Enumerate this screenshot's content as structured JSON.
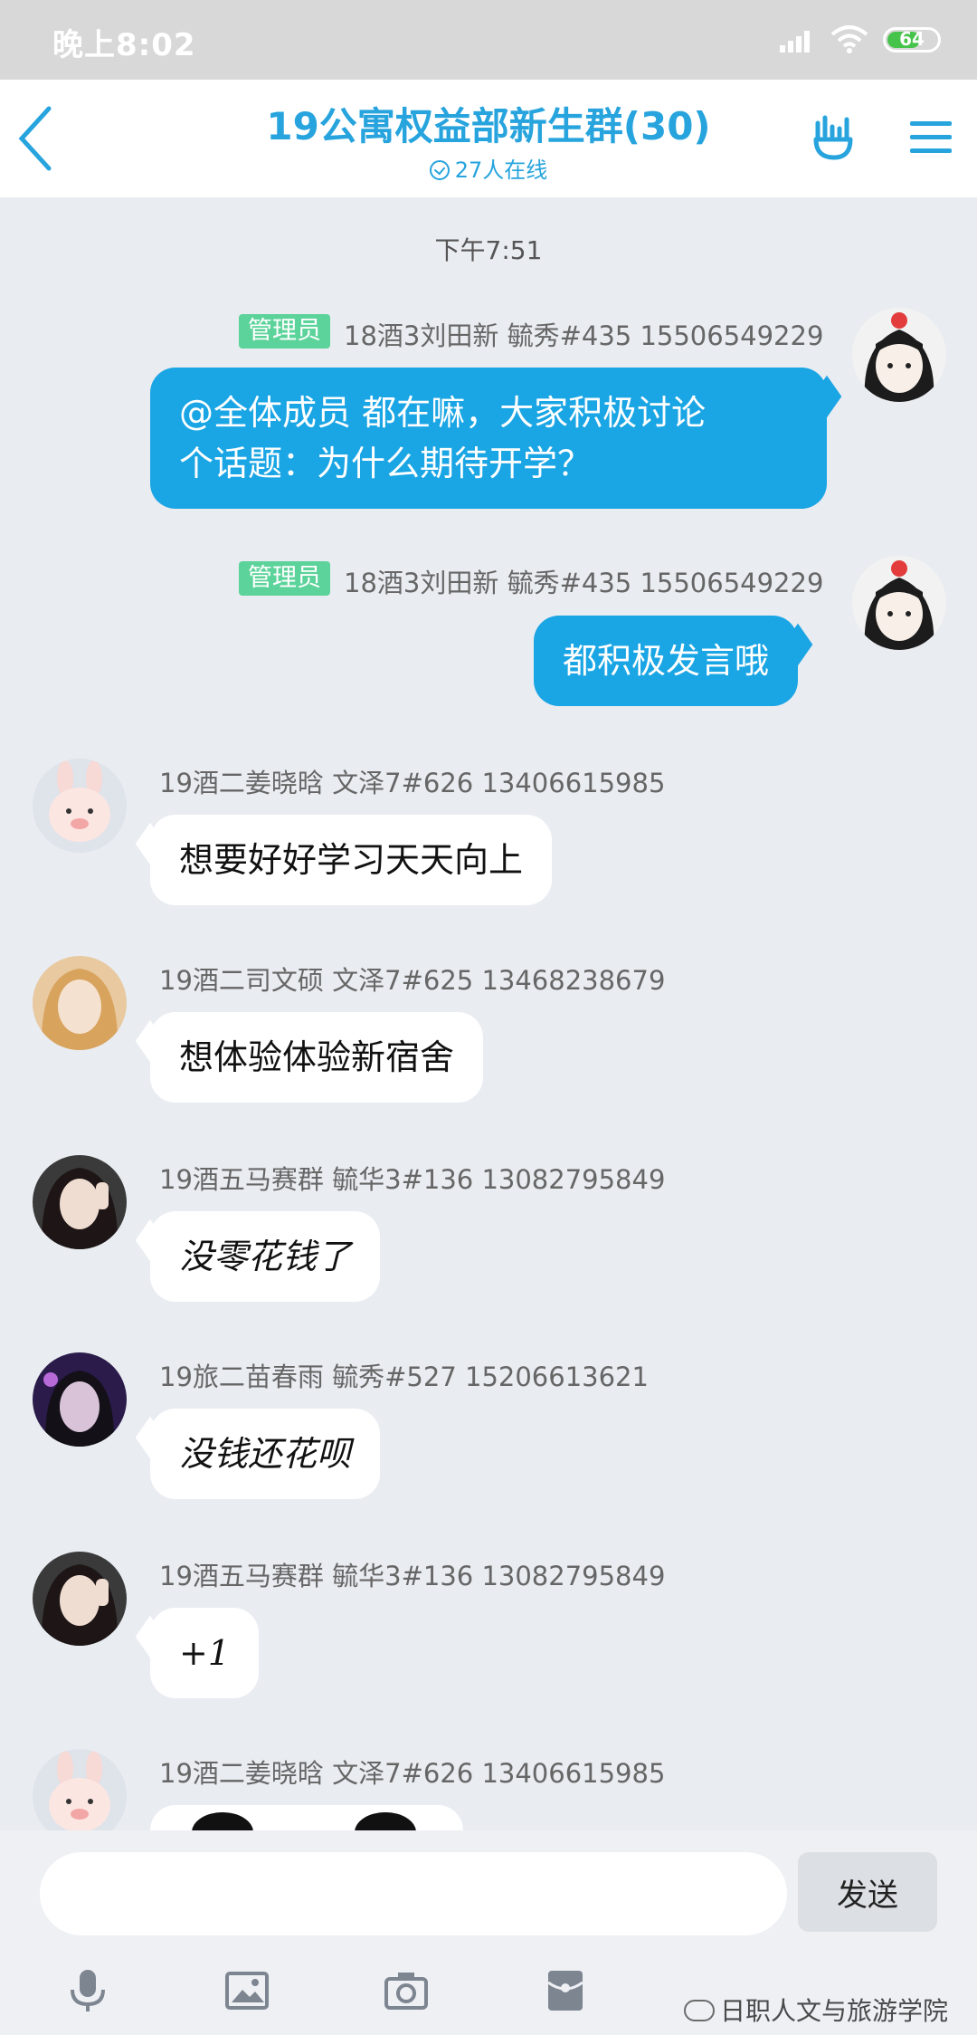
{
  "status_bar": {
    "time": "晚上8:02",
    "battery": "64"
  },
  "header": {
    "title": "19公寓权益部新生群(30)",
    "online": "27人在线"
  },
  "time_separator": "下午7:51",
  "messages": [
    {
      "side": "right",
      "badge": "管理员",
      "sender": "18酒3刘田新 毓秀#435 15506549229",
      "lines": [
        "@全体成员 都在嘛，大家积极讨论",
        "个话题：为什么期待开学？"
      ]
    },
    {
      "side": "right",
      "badge": "管理员",
      "sender": "18酒3刘田新 毓秀#435 15506549229",
      "lines": [
        "都积极发言哦"
      ]
    },
    {
      "side": "left",
      "sender": "19酒二姜晓晗 文泽7#626 13406615985",
      "lines": [
        "想要好好学习天天向上"
      ]
    },
    {
      "side": "left",
      "sender": "19酒二司文硕 文泽7#625 13468238679",
      "lines": [
        "想体验体验新宿舍"
      ]
    },
    {
      "side": "left",
      "sender": "19酒五马赛群 毓华3#136  13082795849",
      "lines": [
        "没零花钱了"
      ]
    },
    {
      "side": "left",
      "sender": "19旅二苗春雨 毓秀#527 15206613621",
      "lines": [
        "没钱还花呗"
      ]
    },
    {
      "side": "left",
      "sender": "19酒五马赛群 毓华3#136  13082795849",
      "lines": [
        "+1"
      ]
    },
    {
      "side": "left",
      "sender": "19酒二姜晓晗 文泽7#626 13406615985",
      "lines": []
    }
  ],
  "input": {
    "placeholder": "",
    "send_label": "发送"
  },
  "toolbar_icons": [
    "microphone-icon",
    "image-icon",
    "camera-icon",
    "red-packet-icon"
  ],
  "watermark": "日职人文与旅游学院",
  "colors": {
    "accent": "#27a4dd",
    "bubble_mine": "#1aa5e4",
    "admin_badge": "#5cd39a",
    "background": "#e9ecf1"
  }
}
